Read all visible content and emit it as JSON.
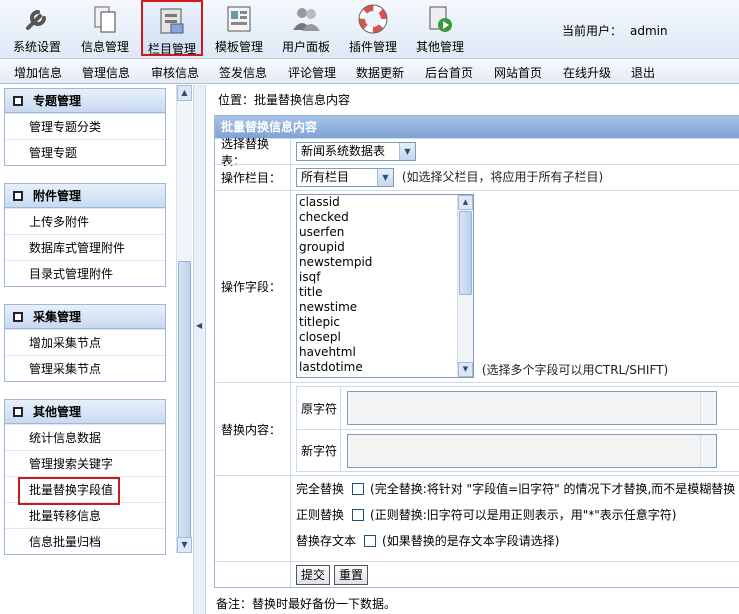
{
  "toolbar": {
    "items": [
      {
        "label": "系统设置",
        "icon": "wrench-icon"
      },
      {
        "label": "信息管理",
        "icon": "documents-icon"
      },
      {
        "label": "栏目管理",
        "icon": "column-icon"
      },
      {
        "label": "模板管理",
        "icon": "template-icon"
      },
      {
        "label": "用户面板",
        "icon": "users-icon"
      },
      {
        "label": "插件管理",
        "icon": "lifebuoy-icon"
      },
      {
        "label": "其他管理",
        "icon": "other-icon"
      }
    ],
    "current_user_label": "当前用户：",
    "current_user": "admin"
  },
  "menu": [
    "增加信息",
    "管理信息",
    "审核信息",
    "签发信息",
    "评论管理",
    "数据更新",
    "后台首页",
    "网站首页",
    "在线升级",
    "退出"
  ],
  "sidebar": {
    "panels": [
      {
        "title": "专题管理",
        "items": [
          "管理专题分类",
          "管理专题"
        ]
      },
      {
        "title": "附件管理",
        "items": [
          "上传多附件",
          "数据库式管理附件",
          "目录式管理附件"
        ]
      },
      {
        "title": "采集管理",
        "items": [
          "增加采集节点",
          "管理采集节点"
        ]
      },
      {
        "title": "其他管理",
        "items": [
          "统计信息数据",
          "管理搜索关键字",
          "批量替换字段值",
          "批量转移信息",
          "信息批量归档"
        ]
      }
    ]
  },
  "main": {
    "location_label": "位置：",
    "location_link": "批量替换信息内容",
    "form_title": "批量替换信息内容",
    "table_label": "选择替换表：",
    "table_value": "新闻系统数据表",
    "column_label": "操作栏目：",
    "column_value": "所有栏目",
    "column_hint": "(如选择父栏目，将应用于所有子栏目)",
    "field_label": "操作字段：",
    "fields": [
      "classid",
      "checked",
      "userfen",
      "groupid",
      "newstempid",
      "isqf",
      "title",
      "newstime",
      "titlepic",
      "closepl",
      "havehtml",
      "lastdotime"
    ],
    "field_hint": "(选择多个字段可以用CTRL/SHIFT)",
    "replace_label": "替换内容：",
    "orig_label": "原字符",
    "new_label": "新字符",
    "full_label": "完全替换",
    "full_hint": "(完全替换:将针对 \"字段值=旧字符\" 的情况下才替换,而不是模糊替换",
    "regex_label": "正则替换",
    "regex_hint": "(正则替换:旧字符可以是用正则表示，用\"*\"表示任意字符)",
    "text_label": "替换存文本",
    "text_hint": "(如果替换的是存文本字段请选择)",
    "submit_label": "提交",
    "reset_label": "重置",
    "note": "备注：替换时最好备份一下数据。"
  }
}
